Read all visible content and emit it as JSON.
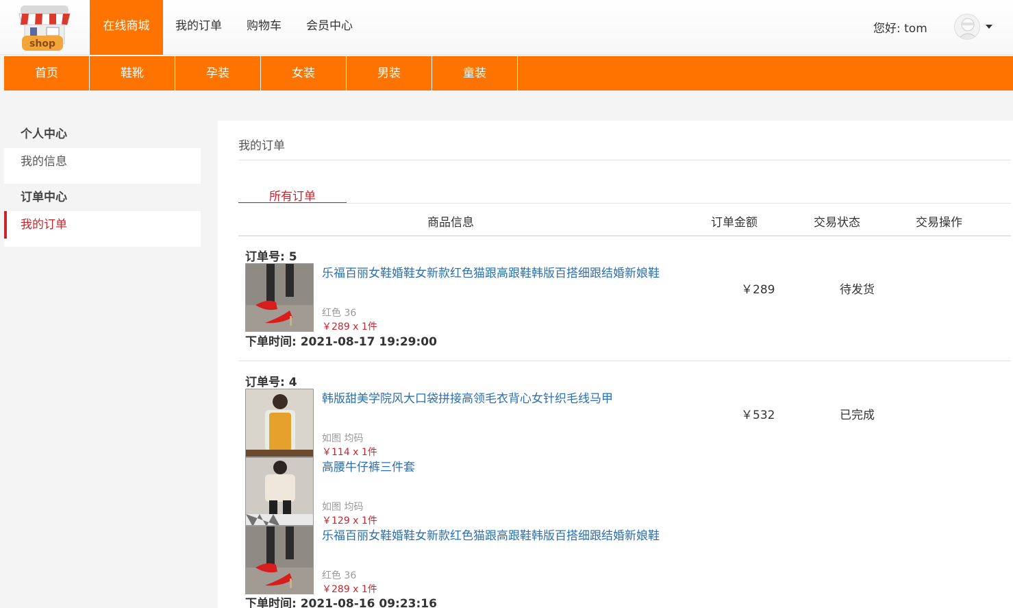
{
  "header": {
    "logo_text": "shop",
    "nav": [
      "在线商城",
      "我的订单",
      "购物车",
      "会员中心"
    ],
    "greeting": "您好: tom"
  },
  "categories": [
    "首页",
    "鞋靴",
    "孕装",
    "女装",
    "男装",
    "童装"
  ],
  "sidebar": {
    "personal_heading": "个人中心",
    "my_info": "我的信息",
    "order_heading": "订单中心",
    "my_orders": "我的订单"
  },
  "main": {
    "title": "我的订单",
    "tab_all": "所有订单",
    "columns": {
      "goods": "商品信息",
      "amount": "订单金额",
      "status": "交易状态",
      "operation": "交易操作"
    }
  },
  "orders": [
    {
      "no_label": "订单号: 5",
      "amount": "￥289",
      "status": "待发货",
      "time_label": "下单时间: 2021-08-17 19:29:00",
      "items": [
        {
          "name": "乐福百丽女鞋婚鞋女新款红色猫跟高跟鞋韩版百搭细跟结婚新娘鞋",
          "spec": "红色 36",
          "price": "￥289 x 1件",
          "image": "red-heels"
        }
      ]
    },
    {
      "no_label": "订单号: 4",
      "amount": "￥532",
      "status": "已完成",
      "time_label": "下单时间: 2021-08-16 09:23:16",
      "items": [
        {
          "name": "韩版甜美学院风大口袋拼接高领毛衣背心女针织毛线马甲",
          "spec": "如图 均码",
          "price": "￥114 x 1件",
          "image": "yellow-vest"
        },
        {
          "name": "高腰牛仔裤三件套",
          "spec": "如图 均码",
          "price": "￥129 x 1件",
          "image": "jacket-set"
        },
        {
          "name": "乐福百丽女鞋婚鞋女新款红色猫跟高跟鞋韩版百搭细跟结婚新娘鞋",
          "spec": "红色 36",
          "price": "￥289 x 1件",
          "image": "red-heels"
        }
      ]
    }
  ],
  "colors": {
    "accent": "#ff7400",
    "active_red": "#c8242d",
    "link_blue": "#2a6fb0"
  }
}
